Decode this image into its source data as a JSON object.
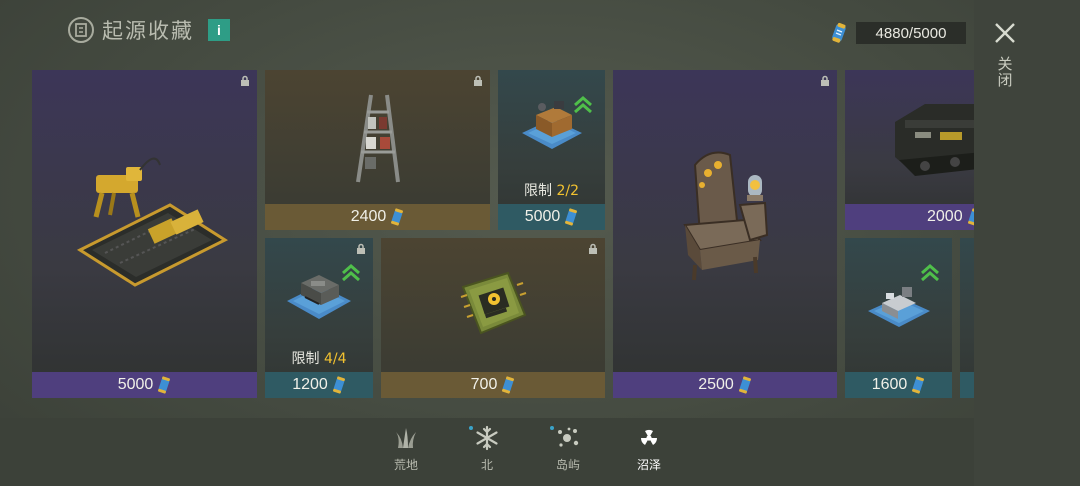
{
  "header": {
    "title": "起源收藏",
    "origin_icon_text": "⓪",
    "info_label": "i"
  },
  "currency": {
    "amount": "4880/5000",
    "icon": "blueprint-scroll-icon"
  },
  "close": {
    "label": "关闭"
  },
  "cards": [
    {
      "id": "robot-dog",
      "price": "5000",
      "rarity": "purple",
      "locked": true
    },
    {
      "id": "weapon-rack",
      "price": "2400",
      "rarity": "gold",
      "locked": true
    },
    {
      "id": "workbench-crate",
      "price": "5000",
      "rarity": "teal",
      "upgrade": true,
      "limit_label": "限制",
      "limit_value": "2/2"
    },
    {
      "id": "throne-chair",
      "price": "2500",
      "rarity": "purple",
      "locked": true
    },
    {
      "id": "armored-vehicle",
      "price": "2000",
      "rarity": "purple"
    },
    {
      "id": "tank-blueprint",
      "price": "1200",
      "rarity": "teal",
      "locked": true,
      "upgrade": true,
      "limit_label": "限制",
      "limit_value": "4/4"
    },
    {
      "id": "radiation-chip",
      "price": "700",
      "rarity": "gold",
      "locked": true
    },
    {
      "id": "desk-blueprint",
      "price": "1600",
      "rarity": "teal",
      "upgrade": true
    }
  ],
  "tabs": [
    {
      "label": "荒地",
      "icon": "grass-icon",
      "active": false,
      "dot": false
    },
    {
      "label": "北",
      "icon": "snowflake-icon",
      "active": false,
      "dot": true
    },
    {
      "label": "岛屿",
      "icon": "sparkle-icon",
      "active": false,
      "dot": true
    },
    {
      "label": "沼泽",
      "icon": "radiation-icon",
      "active": true,
      "dot": false
    }
  ],
  "colors": {
    "accent_teal": "#2e9d86",
    "limit_highlight": "#f2c230",
    "upgrade_green": "#4fbf4a",
    "purple_bar": "#4f3f7e",
    "gold_bar": "#6a5a36",
    "teal_bar": "#2f5a63"
  }
}
